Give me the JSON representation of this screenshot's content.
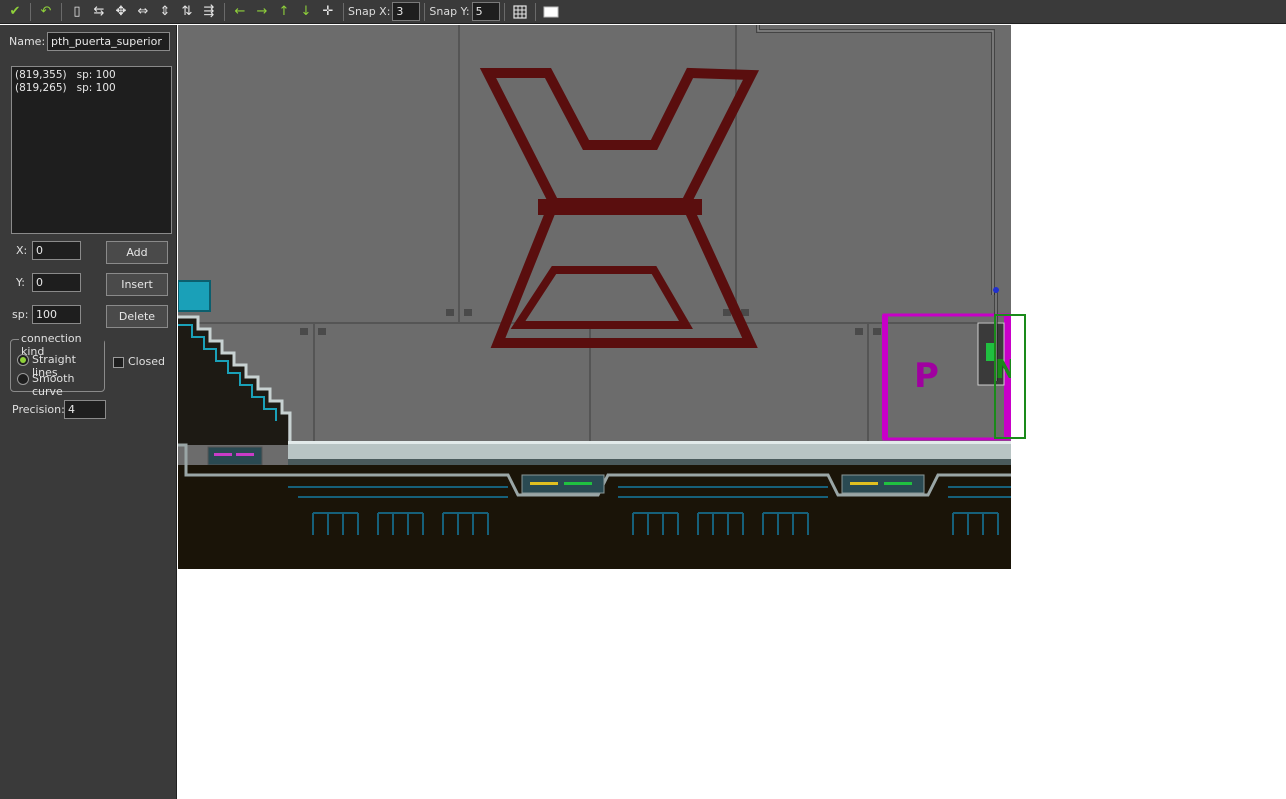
{
  "toolbar": {
    "buttons": [
      {
        "name": "confirm-icon",
        "glyph": "✔"
      },
      {
        "name": "undo-icon",
        "glyph": "↶"
      },
      {
        "name": "new-path-icon",
        "glyph": "▯"
      },
      {
        "name": "reverse-path-icon",
        "glyph": "⇆"
      },
      {
        "name": "shift-path-icon",
        "glyph": "✥"
      },
      {
        "name": "mirror-horizontal-icon",
        "glyph": "⇔"
      },
      {
        "name": "flip-vertical-icon",
        "glyph": "⇕"
      },
      {
        "name": "rotate-icon",
        "glyph": "⇅"
      },
      {
        "name": "scale-path-icon",
        "glyph": "⇶"
      },
      {
        "name": "move-left-icon",
        "glyph": "←"
      },
      {
        "name": "move-right-icon",
        "glyph": "→"
      },
      {
        "name": "move-up-icon",
        "glyph": "↑"
      },
      {
        "name": "move-down-icon",
        "glyph": "↓"
      },
      {
        "name": "center-view-icon",
        "glyph": "✛"
      }
    ],
    "snap_x_label": "Snap X:",
    "snap_x_value": "3",
    "snap_y_label": "Snap Y:",
    "snap_y_value": "5",
    "grid_icon": "grid-icon",
    "room_icon": "show-room-icon"
  },
  "panel": {
    "name_label": "Name:",
    "name_value": "pth_puerta_superior",
    "points": [
      "(819,355)   sp: 100",
      "(819,265)   sp: 100"
    ],
    "x_label": "X:",
    "x_value": "0",
    "y_label": "Y:",
    "y_value": "0",
    "sp_label": "sp:",
    "sp_value": "100",
    "add_label": "Add",
    "insert_label": "Insert",
    "delete_label": "Delete",
    "connection_kind_label": "connection kind",
    "straight_lines_label": "Straight lines",
    "smooth_curve_label": "Smooth curve",
    "closed_label": "Closed",
    "precision_label": "Precision:",
    "precision_value": "4"
  },
  "canvas": {
    "door_letter_p": "P",
    "door_letter_n": "N",
    "colors": {
      "wall": "#6c6c6c",
      "emblem": "#5a0e0e",
      "floor": "#1a1408",
      "accent_teal": "#1aa0b8",
      "path_magenta": "#c800c8",
      "path_green": "#1a8a1a"
    }
  }
}
